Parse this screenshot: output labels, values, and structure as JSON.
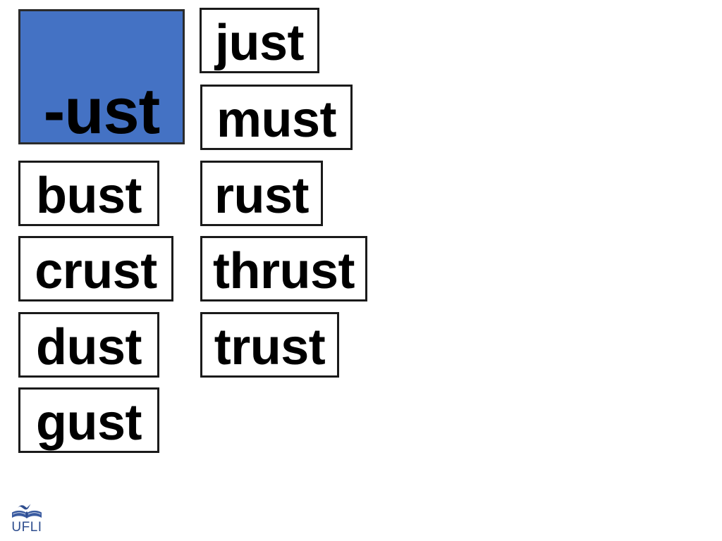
{
  "slide": {
    "kind": "word-family-phonics-slide",
    "background_color": "#ffffff"
  },
  "rime": {
    "label": "-ust",
    "fill_color": "#4472c4",
    "border_color": "#2b2b2b",
    "text_color": "#000000"
  },
  "cards": {
    "border_color": "#1a1a1a",
    "fill_color": "#ffffff",
    "text_color": "#000000",
    "items": [
      {
        "word": "just",
        "column": "right",
        "row": 1
      },
      {
        "word": "must",
        "column": "right",
        "row": 2
      },
      {
        "word": "bust",
        "column": "left",
        "row": 3
      },
      {
        "word": "rust",
        "column": "right",
        "row": 3
      },
      {
        "word": "crust",
        "column": "left",
        "row": 4
      },
      {
        "word": "thrust",
        "column": "right",
        "row": 4
      },
      {
        "word": "dust",
        "column": "left",
        "row": 5
      },
      {
        "word": "trust",
        "column": "right",
        "row": 5
      },
      {
        "word": "gust",
        "column": "left",
        "row": 6
      }
    ]
  },
  "logo": {
    "text": "UFLI",
    "color": "#2e4d8e",
    "mark": "open-book-with-bird-icon"
  }
}
